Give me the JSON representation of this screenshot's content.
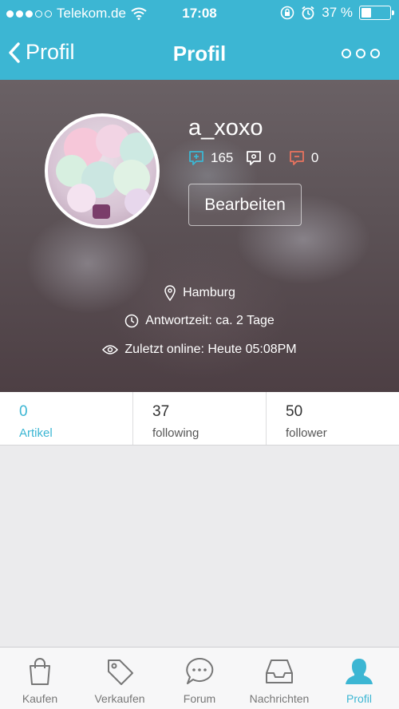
{
  "status": {
    "carrier": "Telekom.de",
    "time": "17:08",
    "battery": "37 %"
  },
  "nav": {
    "back_label": "Profil",
    "title": "Profil"
  },
  "profile": {
    "username": "a_xoxo",
    "ratings": {
      "positive": "165",
      "neutral": "0",
      "negative": "0"
    },
    "edit_label": "Bearbeiten",
    "location": "Hamburg",
    "response_time": "Antwortzeit: ca. 2 Tage",
    "last_online": "Zuletzt online: Heute 05:08PM"
  },
  "tabs": [
    {
      "count": "0",
      "label": "Artikel"
    },
    {
      "count": "37",
      "label": "following"
    },
    {
      "count": "50",
      "label": "follower"
    }
  ],
  "tabbar": [
    {
      "label": "Kaufen",
      "icon": "shopping-bag-icon"
    },
    {
      "label": "Verkaufen",
      "icon": "price-tag-icon"
    },
    {
      "label": "Forum",
      "icon": "chat-bubble-icon"
    },
    {
      "label": "Nachrichten",
      "icon": "inbox-icon"
    },
    {
      "label": "Profil",
      "icon": "person-icon"
    }
  ],
  "colors": {
    "accent": "#3cb6d3",
    "positive": "#3cb6d3",
    "negative": "#e8735f"
  }
}
